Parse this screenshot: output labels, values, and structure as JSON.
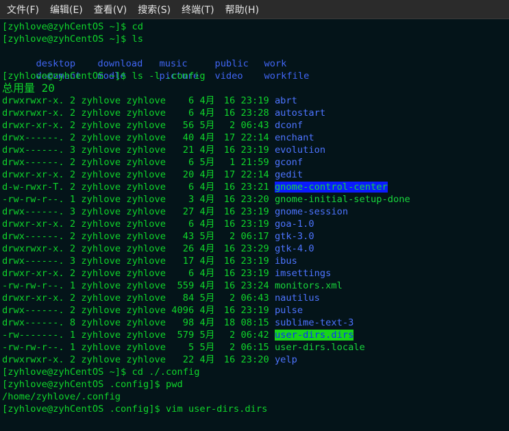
{
  "menu": [
    {
      "label": "文件(F)"
    },
    {
      "label": "编辑(E)"
    },
    {
      "label": "查看(V)"
    },
    {
      "label": "搜索(S)"
    },
    {
      "label": "终端(T)"
    },
    {
      "label": "帮助(H)"
    }
  ],
  "prompt_home": "[zyhlove@zyhCentOS ~]$ ",
  "prompt_config": "[zyhlove@zyhCentOS .config]$ ",
  "cmd1": "cd",
  "cmd2": "ls",
  "ls_home": [
    [
      "desktop",
      "download",
      "music",
      "public",
      "work"
    ],
    [
      "document",
      "modle",
      "picture",
      "video",
      "workfile"
    ]
  ],
  "cmd3": "ls -l .config",
  "total_label": "总用量 20",
  "entries": [
    {
      "perm": "drwxrwxr-x.",
      "links": "2",
      "user": "zyhlove",
      "group": "zyhlove",
      "size": "6",
      "month": "4月",
      "day": "16",
      "time": "23:19",
      "name": "abrt",
      "style": "dir"
    },
    {
      "perm": "drwxrwxr-x.",
      "links": "2",
      "user": "zyhlove",
      "group": "zyhlove",
      "size": "6",
      "month": "4月",
      "day": "16",
      "time": "23:28",
      "name": "autostart",
      "style": "dir"
    },
    {
      "perm": "drwxr-xr-x.",
      "links": "2",
      "user": "zyhlove",
      "group": "zyhlove",
      "size": "56",
      "month": "5月",
      "day": "2",
      "time": "06:43",
      "name": "dconf",
      "style": "dir"
    },
    {
      "perm": "drwx------.",
      "links": "2",
      "user": "zyhlove",
      "group": "zyhlove",
      "size": "40",
      "month": "4月",
      "day": "17",
      "time": "22:14",
      "name": "enchant",
      "style": "dir"
    },
    {
      "perm": "drwx------.",
      "links": "3",
      "user": "zyhlove",
      "group": "zyhlove",
      "size": "21",
      "month": "4月",
      "day": "16",
      "time": "23:19",
      "name": "evolution",
      "style": "dir"
    },
    {
      "perm": "drwx------.",
      "links": "2",
      "user": "zyhlove",
      "group": "zyhlove",
      "size": "6",
      "month": "5月",
      "day": "1",
      "time": "21:59",
      "name": "gconf",
      "style": "dir"
    },
    {
      "perm": "drwxr-xr-x.",
      "links": "2",
      "user": "zyhlove",
      "group": "zyhlove",
      "size": "20",
      "month": "4月",
      "day": "17",
      "time": "22:14",
      "name": "gedit",
      "style": "dir"
    },
    {
      "perm": "d-w-rwxr-T.",
      "links": "2",
      "user": "zyhlove",
      "group": "zyhlove",
      "size": "6",
      "month": "4月",
      "day": "16",
      "time": "23:21",
      "name": "gnome-control-center",
      "style": "hl-blue"
    },
    {
      "perm": "-rw-rw-r--.",
      "links": "1",
      "user": "zyhlove",
      "group": "zyhlove",
      "size": "3",
      "month": "4月",
      "day": "16",
      "time": "23:20",
      "name": "gnome-initial-setup-done",
      "style": "file"
    },
    {
      "perm": "drwx------.",
      "links": "3",
      "user": "zyhlove",
      "group": "zyhlove",
      "size": "27",
      "month": "4月",
      "day": "16",
      "time": "23:19",
      "name": "gnome-session",
      "style": "dir"
    },
    {
      "perm": "drwxr-xr-x.",
      "links": "2",
      "user": "zyhlove",
      "group": "zyhlove",
      "size": "6",
      "month": "4月",
      "day": "16",
      "time": "23:19",
      "name": "goa-1.0",
      "style": "dir"
    },
    {
      "perm": "drwx------.",
      "links": "2",
      "user": "zyhlove",
      "group": "zyhlove",
      "size": "43",
      "month": "5月",
      "day": "2",
      "time": "06:17",
      "name": "gtk-3.0",
      "style": "dir"
    },
    {
      "perm": "drwxrwxr-x.",
      "links": "2",
      "user": "zyhlove",
      "group": "zyhlove",
      "size": "26",
      "month": "4月",
      "day": "16",
      "time": "23:29",
      "name": "gtk-4.0",
      "style": "dir"
    },
    {
      "perm": "drwx------.",
      "links": "3",
      "user": "zyhlove",
      "group": "zyhlove",
      "size": "17",
      "month": "4月",
      "day": "16",
      "time": "23:19",
      "name": "ibus",
      "style": "dir"
    },
    {
      "perm": "drwxr-xr-x.",
      "links": "2",
      "user": "zyhlove",
      "group": "zyhlove",
      "size": "6",
      "month": "4月",
      "day": "16",
      "time": "23:19",
      "name": "imsettings",
      "style": "dir"
    },
    {
      "perm": "-rw-rw-r--.",
      "links": "1",
      "user": "zyhlove",
      "group": "zyhlove",
      "size": "559",
      "month": "4月",
      "day": "16",
      "time": "23:24",
      "name": "monitors.xml",
      "style": "file"
    },
    {
      "perm": "drwxr-xr-x.",
      "links": "2",
      "user": "zyhlove",
      "group": "zyhlove",
      "size": "84",
      "month": "5月",
      "day": "2",
      "time": "06:43",
      "name": "nautilus",
      "style": "dir"
    },
    {
      "perm": "drwx------.",
      "links": "2",
      "user": "zyhlove",
      "group": "zyhlove",
      "size": "4096",
      "month": "4月",
      "day": "16",
      "time": "23:19",
      "name": "pulse",
      "style": "dir"
    },
    {
      "perm": "drwx------.",
      "links": "8",
      "user": "zyhlove",
      "group": "zyhlove",
      "size": "98",
      "month": "4月",
      "day": "18",
      "time": "08:15",
      "name": "sublime-text-3",
      "style": "dir"
    },
    {
      "perm": "-rw-------.",
      "links": "1",
      "user": "zyhlove",
      "group": "zyhlove",
      "size": "579",
      "month": "5月",
      "day": "2",
      "time": "06:42",
      "name": "user-dirs.dirs",
      "style": "hl-green"
    },
    {
      "perm": "-rw-rw-r--.",
      "links": "1",
      "user": "zyhlove",
      "group": "zyhlove",
      "size": "5",
      "month": "5月",
      "day": "2",
      "time": "06:15",
      "name": "user-dirs.locale",
      "style": "file"
    },
    {
      "perm": "drwxrwxr-x.",
      "links": "2",
      "user": "zyhlove",
      "group": "zyhlove",
      "size": "22",
      "month": "4月",
      "day": "16",
      "time": "23:20",
      "name": "yelp",
      "style": "dir"
    }
  ],
  "cmd4": "cd ./.config",
  "cmd5": "pwd",
  "pwd_output": "/home/zyhlove/.config",
  "cmd6": "vim user-dirs.dirs",
  "colors": {
    "text": "#10d62b",
    "dir": "#4d74ff",
    "home_listing": "#4166f5",
    "highlight_blue_bg": "#0b1bff",
    "highlight_green_bg": "#17d41a",
    "background": "#041419",
    "menubar": "#2b2b2b"
  }
}
